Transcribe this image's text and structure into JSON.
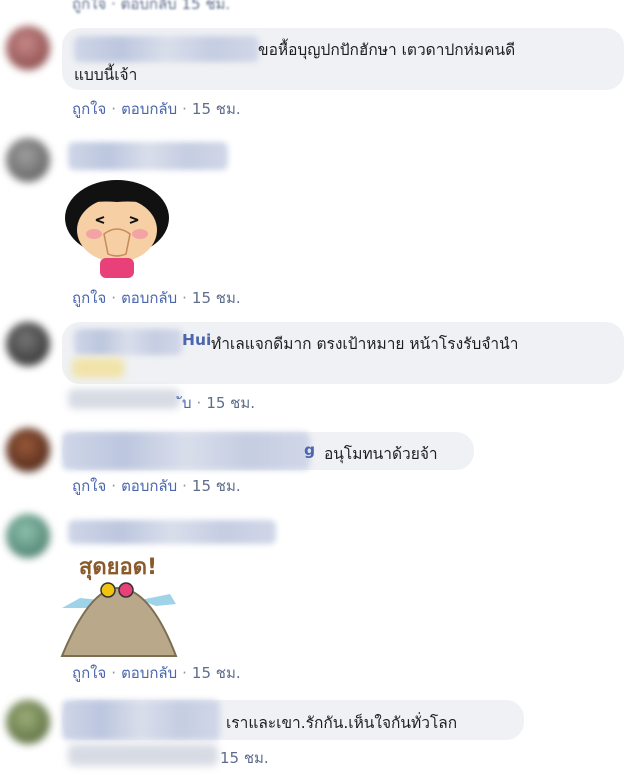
{
  "actions": {
    "like": "ถูกใจ",
    "reply": "ตอบกลับ",
    "sep": "·"
  },
  "top_time": "15 ชม.",
  "comments": [
    {
      "text": "ขอหื้อบุญปกปักฮักษา เตวดาปกห่มคนดีแบบนี้เจ้า",
      "line1": "ขอหื้อบุญปกปักฮักษา เตวดาปกห่มคนดี",
      "line2": "แบบนี้เจ้า",
      "time": "15 ชม."
    },
    {
      "sticker": "girl-blushing-sticker",
      "time": "15 ชม."
    },
    {
      "name_tail": "Hui",
      "text": "ทำเลแจกดีมาก ตรงเป้าหมาย หน้าโรงรับจำนำ",
      "reply_tail": "ับ",
      "time": "15 ชม."
    },
    {
      "name_tail": "g",
      "text": "อนุโมทนาด้วยจ้า",
      "time": "15 ชม."
    },
    {
      "sticker": "sud-yod-sticker",
      "sticker_text": "สุดยอด!",
      "time": "15 ชม."
    },
    {
      "text": "เราและเขา.รักกัน.เห็นใจกันทั่วโลก",
      "time": "15 ชม."
    }
  ],
  "colors": {
    "link": "#4a67ad",
    "bubble": "#eff1f4",
    "meta": "#5e6d8c"
  }
}
